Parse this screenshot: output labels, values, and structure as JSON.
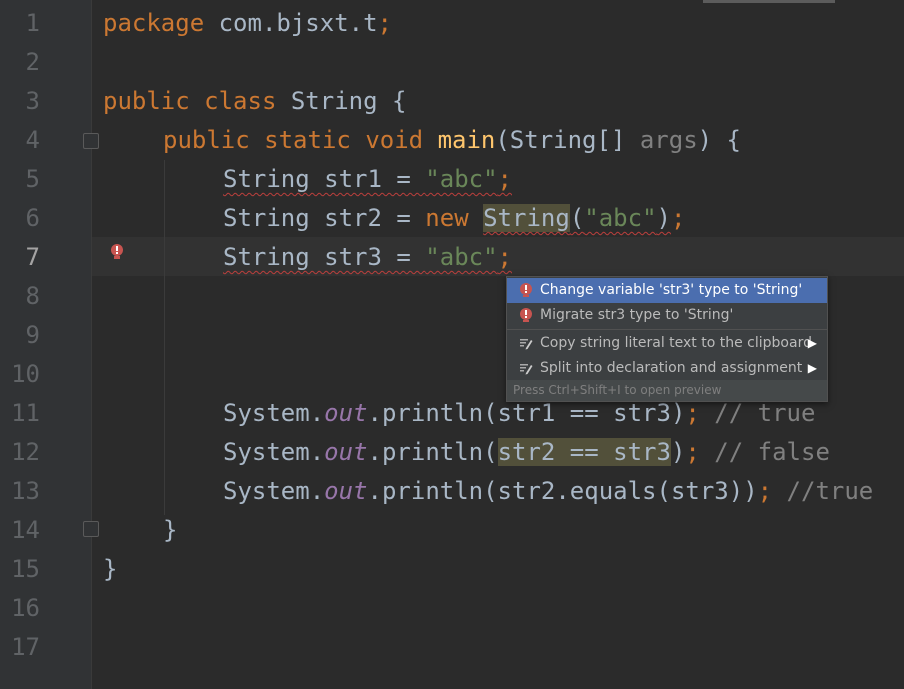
{
  "editor": {
    "line_numbers": [
      "1",
      "2",
      "3",
      "4",
      "5",
      "6",
      "7",
      "8",
      "9",
      "10",
      "11",
      "12",
      "13",
      "14",
      "15",
      "16",
      "17"
    ],
    "current_line": "7"
  },
  "code": {
    "l1": {
      "kw": "package",
      "rest": " com.bjsxt.t",
      "semi": ";"
    },
    "l3": {
      "kw1": "public",
      "kw2": "class",
      "rest": " String {"
    },
    "l4": {
      "kw1": "public",
      "kw2": "static",
      "kw3": "void",
      "fn": "main",
      "p1": "(String[] ",
      "param": "args",
      "p2": ") {"
    },
    "l5": {
      "t1": "String str1 = ",
      "str": "\"abc\"",
      "semi": ";"
    },
    "l6": {
      "t1": "String str2 = ",
      "kw": "new",
      "t2": "String",
      "t3": "(",
      "str": "\"abc\"",
      "t4": ")",
      "semi": ";"
    },
    "l7": {
      "t1": "String str3 = ",
      "str": "\"abc\"",
      "semi": ";"
    },
    "l11": {
      "sys": "System.",
      "fld": "out",
      "call": ".println(str1 == str3)",
      "semi": ";",
      "cmt": " // true"
    },
    "l12": {
      "sys": "System.",
      "fld": "out",
      "call1": ".println(",
      "hl": "str2 == str3",
      "call2": ")",
      "semi": ";",
      "cmt": " // false"
    },
    "l13": {
      "sys": "System.",
      "fld": "out",
      "call": ".println(str2.equals(str3))",
      "semi": ";",
      "cmt": " //true"
    },
    "l14": {
      "t": "}"
    },
    "l15": {
      "t": "}"
    }
  },
  "popup": {
    "items": [
      {
        "label": "Change variable 'str3' type to 'String'",
        "icon": "error-bulb-icon"
      },
      {
        "label": "Migrate str3 type to 'String'",
        "icon": "error-bulb-icon"
      },
      {
        "label": "Copy string literal text to the clipboard",
        "icon": "pencil-icon",
        "arrow": "▶"
      },
      {
        "label": "Split into declaration and assignment",
        "icon": "pencil-icon",
        "arrow": "▶"
      }
    ],
    "hint": "Press Ctrl+Shift+I to open preview"
  },
  "colors": {
    "background": "#2b2b2b",
    "keyword": "#cc7832",
    "string": "#6a8759",
    "selection": "#4b6eaf",
    "error": "#bc3f3c"
  }
}
